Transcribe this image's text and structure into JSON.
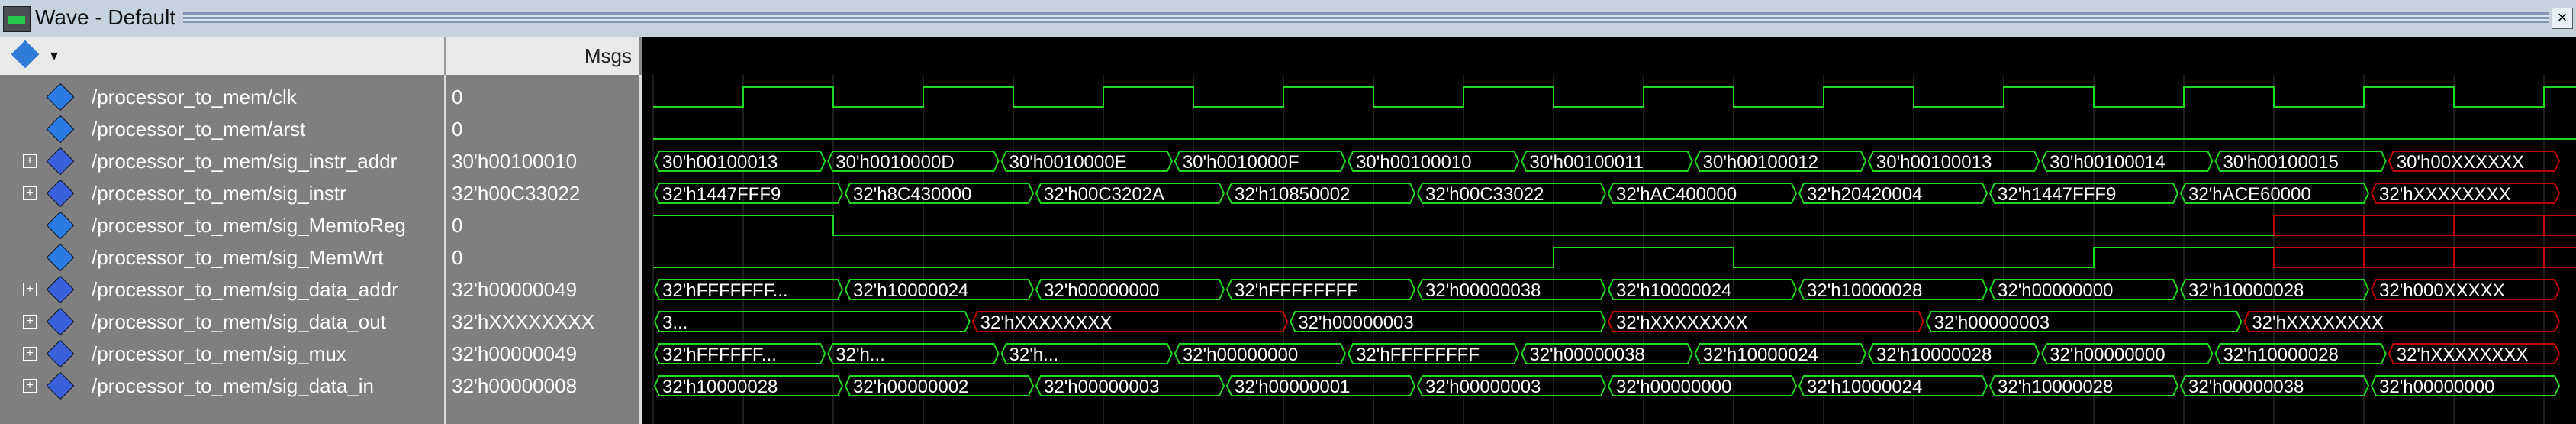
{
  "window": {
    "title": "Wave - Default",
    "close_label": "×"
  },
  "header": {
    "msgs_label": "Msgs"
  },
  "signals": [
    {
      "name": "/processor_to_mem/clk",
      "value": "0",
      "icon": "clock-signal-icon",
      "expandable": false,
      "kind": "bit",
      "levels": [
        "l",
        "h",
        "l",
        "h",
        "l",
        "h",
        "l",
        "h",
        "l",
        "h",
        "l",
        "h",
        "l",
        "h",
        "l",
        "h",
        "l",
        "h",
        "l",
        "h",
        "l",
        "h"
      ]
    },
    {
      "name": "/processor_to_mem/arst",
      "value": "0",
      "icon": "signal-icon",
      "expandable": false,
      "kind": "bit",
      "levels": [
        "l",
        "l",
        "l",
        "l",
        "l",
        "l",
        "l",
        "l",
        "l",
        "l",
        "l",
        "l",
        "l",
        "l",
        "l",
        "l",
        "l",
        "l",
        "l",
        "l",
        "l",
        "l"
      ]
    },
    {
      "name": "/processor_to_mem/sig_instr_addr",
      "value": "30'h00100010",
      "icon": "bus-signal-icon",
      "expandable": true,
      "kind": "bus",
      "segments": [
        {
          "t": "30'h00100013",
          "c": "g"
        },
        {
          "t": "30'h0010000D",
          "c": "g"
        },
        {
          "t": "30'h0010000E",
          "c": "g"
        },
        {
          "t": "30'h0010000F",
          "c": "g"
        },
        {
          "t": "30'h00100010",
          "c": "g"
        },
        {
          "t": "30'h00100011",
          "c": "g"
        },
        {
          "t": "30'h00100012",
          "c": "g"
        },
        {
          "t": "30'h00100013",
          "c": "g"
        },
        {
          "t": "30'h00100014",
          "c": "g"
        },
        {
          "t": "30'h00100015",
          "c": "g"
        },
        {
          "t": "30'h00XXXXXX",
          "c": "r"
        }
      ]
    },
    {
      "name": "/processor_to_mem/sig_instr",
      "value": "32'h00C33022",
      "icon": "bus-signal-icon",
      "expandable": true,
      "kind": "bus",
      "segments": [
        {
          "t": "32'h1447FFF9",
          "c": "g"
        },
        {
          "t": "32'h8C430000",
          "c": "g"
        },
        {
          "t": "32'h00C3202A",
          "c": "g"
        },
        {
          "t": "32'h10850002",
          "c": "g"
        },
        {
          "t": "32'h00C33022",
          "c": "g"
        },
        {
          "t": "32'hAC400000",
          "c": "g"
        },
        {
          "t": "32'h20420004",
          "c": "g"
        },
        {
          "t": "32'h1447FFF9",
          "c": "g"
        },
        {
          "t": "32'hACE60000",
          "c": "g"
        },
        {
          "t": "32'hXXXXXXXX",
          "c": "r"
        }
      ]
    },
    {
      "name": "/processor_to_mem/sig_MemtoReg",
      "value": "0",
      "icon": "signal-icon",
      "expandable": false,
      "kind": "bit",
      "levels": [
        "h",
        "h",
        "l",
        "l",
        "l",
        "l",
        "l",
        "l",
        "l",
        "l",
        "l",
        "l",
        "l",
        "l",
        "l",
        "l",
        "l",
        "l",
        "x",
        "x",
        "x",
        "x"
      ]
    },
    {
      "name": "/processor_to_mem/sig_MemWrt",
      "value": "0",
      "icon": "signal-icon",
      "expandable": false,
      "kind": "bit",
      "levels": [
        "l",
        "l",
        "l",
        "l",
        "l",
        "l",
        "l",
        "l",
        "l",
        "l",
        "h",
        "h",
        "l",
        "l",
        "l",
        "l",
        "h",
        "h",
        "x",
        "x",
        "x",
        "x"
      ]
    },
    {
      "name": "/processor_to_mem/sig_data_addr",
      "value": "32'h00000049",
      "icon": "bus-signal-icon",
      "expandable": true,
      "kind": "bus",
      "segments": [
        {
          "t": "32'hFFFFFFF...",
          "c": "g"
        },
        {
          "t": "32'h10000024",
          "c": "g"
        },
        {
          "t": "32'h00000000",
          "c": "g"
        },
        {
          "t": "32'hFFFFFFFF",
          "c": "g"
        },
        {
          "t": "32'h00000038",
          "c": "g"
        },
        {
          "t": "32'h10000024",
          "c": "g"
        },
        {
          "t": "32'h10000028",
          "c": "g"
        },
        {
          "t": "32'h00000000",
          "c": "g"
        },
        {
          "t": "32'h10000028",
          "c": "g"
        },
        {
          "t": "32'h000XXXXX",
          "c": "r"
        }
      ]
    },
    {
      "name": "/processor_to_mem/sig_data_out",
      "value": "32'hXXXXXXXX",
      "icon": "bus-signal-icon",
      "expandable": true,
      "kind": "bus",
      "segments": [
        {
          "t": "3...",
          "c": "g"
        },
        {
          "t": "32'hXXXXXXXX",
          "c": "r"
        },
        {
          "t": "32'h00000003",
          "c": "g"
        },
        {
          "t": "32'hXXXXXXXX",
          "c": "r"
        },
        {
          "t": "32'h00000003",
          "c": "g"
        },
        {
          "t": "32'hXXXXXXXX",
          "c": "r"
        }
      ]
    },
    {
      "name": "/processor_to_mem/sig_mux",
      "value": "32'h00000049",
      "icon": "bus-signal-icon",
      "expandable": true,
      "kind": "bus",
      "segments": [
        {
          "t": "32'hFFFFFF...",
          "c": "g"
        },
        {
          "t": "32'h...",
          "c": "g"
        },
        {
          "t": "32'h...",
          "c": "g"
        },
        {
          "t": "32'h00000000",
          "c": "g"
        },
        {
          "t": "32'hFFFFFFFF",
          "c": "g"
        },
        {
          "t": "32'h00000038",
          "c": "g"
        },
        {
          "t": "32'h10000024",
          "c": "g"
        },
        {
          "t": "32'h10000028",
          "c": "g"
        },
        {
          "t": "32'h00000000",
          "c": "g"
        },
        {
          "t": "32'h10000028",
          "c": "g"
        },
        {
          "t": "32'hXXXXXXXX",
          "c": "r"
        }
      ]
    },
    {
      "name": "/processor_to_mem/sig_data_in",
      "value": "32'h00000008",
      "icon": "bus-signal-icon",
      "expandable": true,
      "kind": "bus",
      "segments": [
        {
          "t": "32'h10000028",
          "c": "g"
        },
        {
          "t": "32'h00000002",
          "c": "g"
        },
        {
          "t": "32'h00000003",
          "c": "g"
        },
        {
          "t": "32'h00000001",
          "c": "g"
        },
        {
          "t": "32'h00000003",
          "c": "g"
        },
        {
          "t": "32'h00000000",
          "c": "g"
        },
        {
          "t": "32'h10000024",
          "c": "g"
        },
        {
          "t": "32'h10000028",
          "c": "g"
        },
        {
          "t": "32'h00000038",
          "c": "g"
        },
        {
          "t": "32'h00000000",
          "c": "g"
        }
      ]
    }
  ],
  "colors": {
    "wave_green": "#1fd91f",
    "wave_red": "#c00000",
    "grid": "#3a3a3a",
    "label": "#ffffff"
  }
}
